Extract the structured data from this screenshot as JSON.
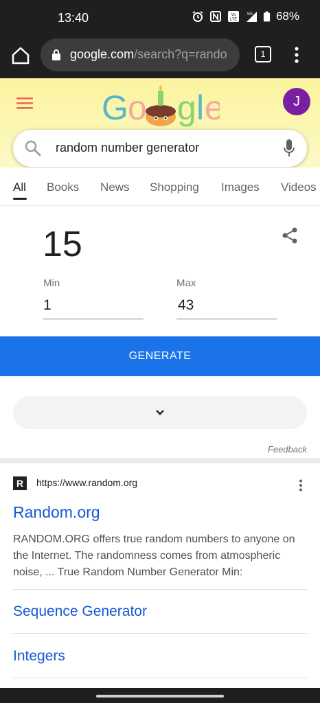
{
  "status_bar": {
    "time": "13:40",
    "battery": "68%",
    "icons": [
      "alarm-icon",
      "nfc-icon",
      "volte-icon",
      "signal-5g-icon",
      "battery-icon"
    ]
  },
  "browser": {
    "url_domain": "google.com",
    "url_path": "/search?q=rando",
    "tab_count": "1"
  },
  "header": {
    "avatar_letter": "J",
    "brand_colors": [
      "#4285f4",
      "#ea4335",
      "#fbbc05",
      "#34a853"
    ]
  },
  "search": {
    "query": "random number generator"
  },
  "tabs": [
    {
      "label": "All"
    },
    {
      "label": "Books"
    },
    {
      "label": "News"
    },
    {
      "label": "Shopping"
    },
    {
      "label": "Images"
    },
    {
      "label": "Videos"
    }
  ],
  "rng": {
    "result": "15",
    "min_label": "Min",
    "min_value": "1",
    "max_label": "Max",
    "max_value": "43",
    "generate_label": "GENERATE",
    "feedback_label": "Feedback"
  },
  "result": {
    "url": "https://www.random.org",
    "favicon_letter": "R",
    "title": "Random.org",
    "snippet": "RANDOM.ORG offers true random numbers to anyone on the Internet. The randomness comes from atmospheric noise, ... True Random Number Generator Min:",
    "sitelinks": [
      {
        "label": "Sequence Generator"
      },
      {
        "label": "Integers"
      }
    ]
  },
  "colors": {
    "accent": "#1a73e8",
    "link": "#1558d6",
    "avatar": "#7b1fa2"
  }
}
